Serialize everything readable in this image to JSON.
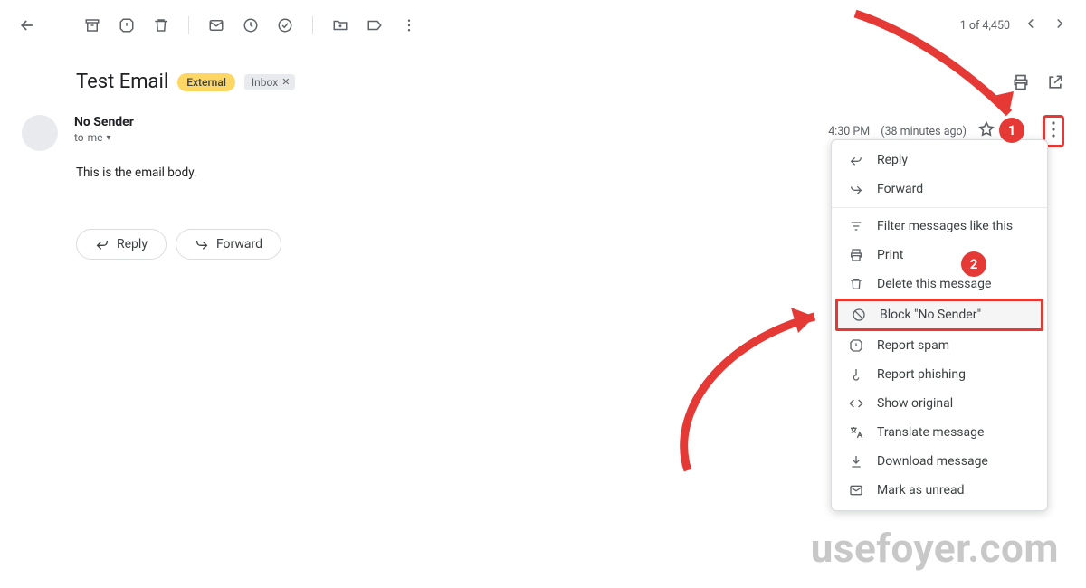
{
  "pager": {
    "text": "1 of 4,450"
  },
  "subject": "Test Email",
  "chips": {
    "external": "External",
    "inbox": "Inbox"
  },
  "sender": {
    "name": "No Sender",
    "to_prefix": "to",
    "to_target": "me"
  },
  "meta": {
    "time": "4:30 PM",
    "age": "(38 minutes ago)"
  },
  "body": "This is the email body.",
  "buttons": {
    "reply": "Reply",
    "forward": "Forward"
  },
  "menu": {
    "reply": "Reply",
    "forward": "Forward",
    "filter": "Filter messages like this",
    "print": "Print",
    "delete": "Delete this message",
    "block": "Block \"No Sender\"",
    "spam": "Report spam",
    "phishing": "Report phishing",
    "original": "Show original",
    "translate": "Translate message",
    "download": "Download message",
    "unread": "Mark as unread"
  },
  "callouts": {
    "one": "1",
    "two": "2"
  },
  "watermark": "usefoyer.com"
}
